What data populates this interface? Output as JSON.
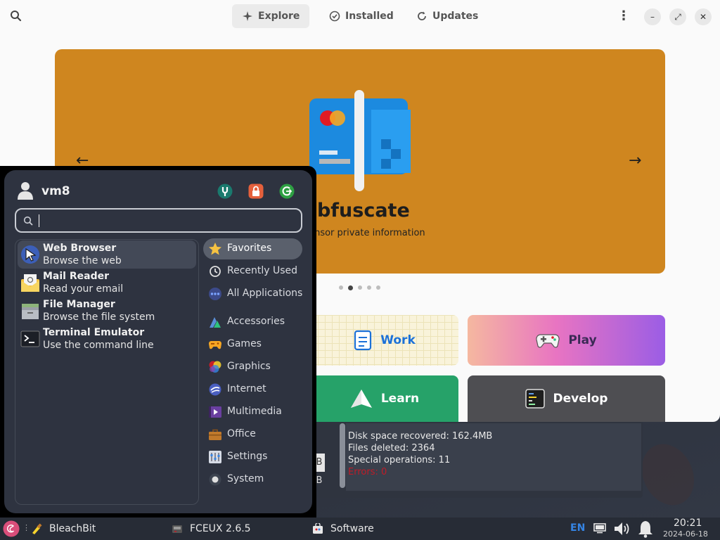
{
  "software": {
    "tabs": [
      {
        "label": "Explore",
        "active": true
      },
      {
        "label": "Installed",
        "active": false
      },
      {
        "label": "Updates",
        "active": false
      }
    ],
    "banner": {
      "title": "Obfuscate",
      "subtitle": "Censor private information",
      "color": "#cf861f",
      "pages": 5,
      "current_page": 2
    },
    "categories": [
      {
        "label": "Work",
        "icon": "clipboard-icon"
      },
      {
        "label": "Play",
        "icon": "gamepad-icon"
      },
      {
        "label": "Learn",
        "icon": "paper-plane-icon"
      },
      {
        "label": "Develop",
        "icon": "terminal-icon"
      }
    ]
  },
  "bleachbit": {
    "log": [
      "Disk space recovered: 162.4MB",
      "Files deleted: 2364",
      "Special operations: 11",
      "Errors: 0"
    ],
    "left_box_1": "B",
    "left_box_2": "B"
  },
  "menu": {
    "user": "vm8",
    "actions": [
      "settings-icon",
      "lock-icon",
      "logout-icon"
    ],
    "search": {
      "value": "",
      "placeholder": ""
    },
    "apps": [
      {
        "name": "Web Browser",
        "desc": "Browse the web",
        "icon": "web-browser-icon"
      },
      {
        "name": "Mail Reader",
        "desc": "Read your email",
        "icon": "mail-icon"
      },
      {
        "name": "File Manager",
        "desc": "Browse the file system",
        "icon": "folder-icon"
      },
      {
        "name": "Terminal Emulator",
        "desc": "Use the command line",
        "icon": "terminal-icon"
      }
    ],
    "categories": [
      {
        "label": "Favorites",
        "icon": "star-icon"
      },
      {
        "label": "Recently Used",
        "icon": "clock-icon"
      },
      {
        "label": "All Applications",
        "icon": "dots-icon"
      },
      {
        "label": "Accessories",
        "icon": "accessories-icon"
      },
      {
        "label": "Games",
        "icon": "games-icon"
      },
      {
        "label": "Graphics",
        "icon": "graphics-icon"
      },
      {
        "label": "Internet",
        "icon": "internet-icon"
      },
      {
        "label": "Multimedia",
        "icon": "multimedia-icon"
      },
      {
        "label": "Office",
        "icon": "office-icon"
      },
      {
        "label": "Settings",
        "icon": "settings-icon"
      },
      {
        "label": "System",
        "icon": "system-icon"
      }
    ]
  },
  "panel": {
    "tasks": [
      "BleachBit",
      "FCEUX 2.6.5",
      "Software"
    ],
    "keyboard_layout": "EN",
    "time": "20:21",
    "date": "2024-06-18"
  }
}
